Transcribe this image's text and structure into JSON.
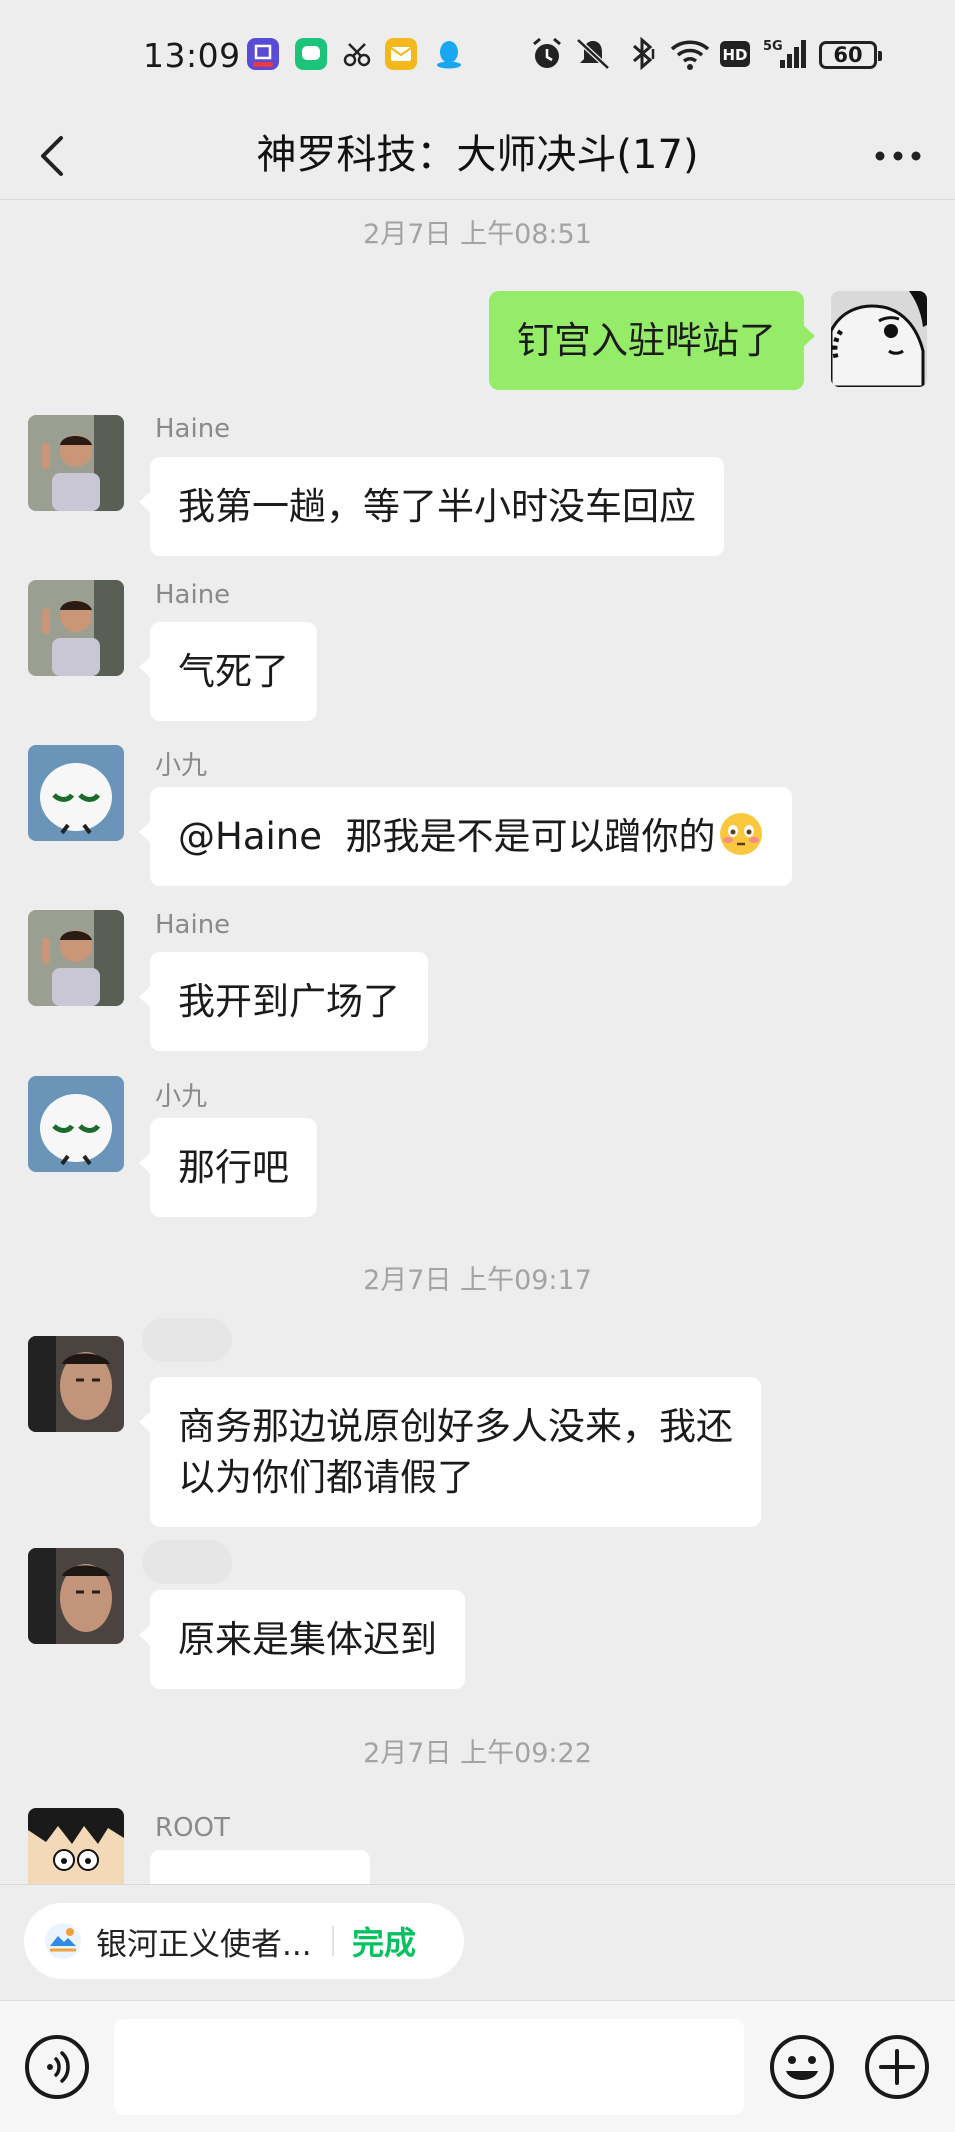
{
  "status_bar": {
    "time": "13:09",
    "app_icons": [
      "tieba-icon",
      "message-icon",
      "scissors-app-icon",
      "mail-icon",
      "qq-penguin-icon"
    ],
    "system_icons": [
      "alarm-icon",
      "mute-icon",
      "bluetooth-icon",
      "wifi-icon",
      "hd-icon",
      "5g-signal-icon"
    ],
    "battery": "60"
  },
  "header": {
    "title": "神罗科技：大师决斗(17)"
  },
  "messages": [
    {
      "type": "timestamp",
      "text": "2月7日 上午08:51"
    },
    {
      "type": "msg",
      "self": true,
      "text": "钉宫入驻哔站了"
    },
    {
      "type": "msg",
      "sender": "Haine",
      "text": "我第一趟，等了半小时没车回应"
    },
    {
      "type": "msg",
      "sender": "Haine",
      "text": "气死了"
    },
    {
      "type": "msg",
      "sender": "小九",
      "text": "@Haine  那我是不是可以蹭你的",
      "emoji": "flushed-face-emoji"
    },
    {
      "type": "msg",
      "sender": "Haine",
      "text": "我开到广场了"
    },
    {
      "type": "msg",
      "sender": "小九",
      "text": "那行吧"
    },
    {
      "type": "timestamp",
      "text": "2月7日 上午09:17"
    },
    {
      "type": "msg",
      "sender": "",
      "text": "商务那边说原创好多人没来，我还\n以为你们都请假了"
    },
    {
      "type": "msg",
      "sender": "",
      "text": "原来是集体迟到"
    },
    {
      "type": "timestamp",
      "text": "2月7日 上午09:22"
    },
    {
      "type": "msg",
      "sender": "ROOT",
      "text": ""
    }
  ],
  "floating_pill": {
    "text": "银河正义使者...",
    "action": "完成"
  },
  "input_bar": {
    "value": "",
    "left_icon": "voice-icon",
    "emoji_icon": "emoji-icon",
    "plus_icon": "plus-icon"
  },
  "colors": {
    "background": "#ededed",
    "self_bubble": "#95ec69",
    "other_bubble": "#ffffff",
    "accent_green": "#07c160"
  }
}
